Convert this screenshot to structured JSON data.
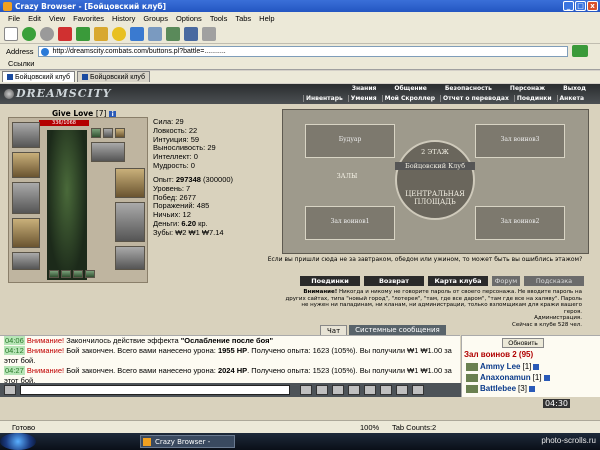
{
  "window": {
    "title": "Crazy Browser - [Бойцовский клуб]",
    "minimize": "_",
    "maximize": "□",
    "close": "x"
  },
  "menu": [
    "File",
    "Edit",
    "View",
    "Favorites",
    "History",
    "Groups",
    "Options",
    "Tools",
    "Tabs",
    "Help"
  ],
  "address": {
    "label": "Address",
    "url": "http://dreamscity.combats.com/buttons.pl?battle=..........."
  },
  "links": {
    "label": "Ссылки"
  },
  "browser_tabs": [
    "Бойцовский клуб",
    "Бойцовский клуб"
  ],
  "game": {
    "logo": "DREAMSCITY",
    "nav_top": [
      "Знания",
      "Общение",
      "Безопасность",
      "Персонаж",
      "Выход"
    ],
    "nav_sub": [
      "Инвентарь",
      "Умения",
      "Мой Скроллер",
      "Отчет о переводах",
      "Поединки",
      "Анкета"
    ],
    "character": {
      "name": "Give Love",
      "level": "[7]",
      "info_icon": "i",
      "hp": "336/1068"
    },
    "stats": [
      "Сила: 29",
      "Ловкость: 22",
      "Интуиция: 59",
      "Выносливость: 29",
      "Интеллект: 0",
      "Мудрость: 0"
    ],
    "stats2": {
      "exp_label": "Опыт: ",
      "exp_value": "297348",
      "exp_next": " (300000)",
      "lines": [
        "Уровень: 7",
        "Побед: 2677",
        "Поражений: 485",
        "Ничьих: 12"
      ],
      "money_label": "Деньги: ",
      "money_value": "6.20",
      "money_unit": " кр.",
      "teeth": "Зубы: ₩2 ₩1 ₩7.14"
    },
    "map": {
      "zones": [
        "Будуар",
        "Зал воинов3",
        "ЗАЛЫ",
        "Зал воинов1",
        "Зал воинов2"
      ],
      "center_top": "2 ЭТАЖ",
      "center_mid": "Бойцовский Клуб",
      "center_bottom": "ЦЕНТРАЛЬНАЯ ПЛОЩАДЬ"
    },
    "map_caption": "Если вы пришли сюда не за завтраком, обедом или ужином, то может быть вы ошиблись этажом?",
    "buttons": [
      "Поединки",
      "Возврат",
      "Карта клуба",
      "Форум",
      "Подсказка"
    ],
    "warning_bold": "Внимание!",
    "warning_text": " Никогда и никому не говорите пароль от своего персонажа. Не вводите пароль на других сайтах, типа \"новый город\", \"лотерея\", \"там, где все даром\", \"там где все на халяву\". Пароль не нужен ни паладинам, ни кланам, ни администрации, только взломщикам для кражи вашего героя.",
    "admin_sig": "Администрация.",
    "online": "Сейчас в клубе 528 чел."
  },
  "chat_tabs": [
    "Чат",
    "Системные сообщения"
  ],
  "chat": [
    {
      "time": "04:06",
      "warn": "Внимание!",
      "text": " Закончилось действие эффекта ",
      "bold": "\"Ослабление после боя\"",
      "rest": ""
    },
    {
      "time": "04:12",
      "warn": "Внимание!",
      "text": " Бой закончен. Всего вами нанесено урона: ",
      "bold": "1955 HP",
      "rest": ". Получено опыта: 1623 (105%). Вы получили ₩1 ₩1.00 за этот бой."
    },
    {
      "time": "04:27",
      "warn": "Внимание!",
      "text": " Бой закончен. Всего вами нанесено урона: ",
      "bold": "2024 HP",
      "rest": ". Получено опыта: 1523 (105%). Вы получили ₩1 ₩1.00 за этот бой."
    }
  ],
  "room": {
    "refresh": "Обновить",
    "title": "Зал воинов 2 (95)",
    "players": [
      {
        "name": "Ammy Lee",
        "level": "[1]"
      },
      {
        "name": "Anaxonamun",
        "level": "[1]"
      },
      {
        "name": "Battlebee",
        "level": "[3]"
      }
    ]
  },
  "clock": "04:30",
  "status": {
    "text": "Готово",
    "zoom": "100%",
    "tabs": "Tab Counts:2"
  },
  "taskbar": {
    "app": "Crazy Browser - [Бой...",
    "watermark": "photo-scrolls.ru"
  },
  "colors": {
    "title_blue": "#2456c2",
    "game_dark": "#2a2d2f",
    "warn_red": "#c00000",
    "time_green": "#2a7a2a"
  }
}
